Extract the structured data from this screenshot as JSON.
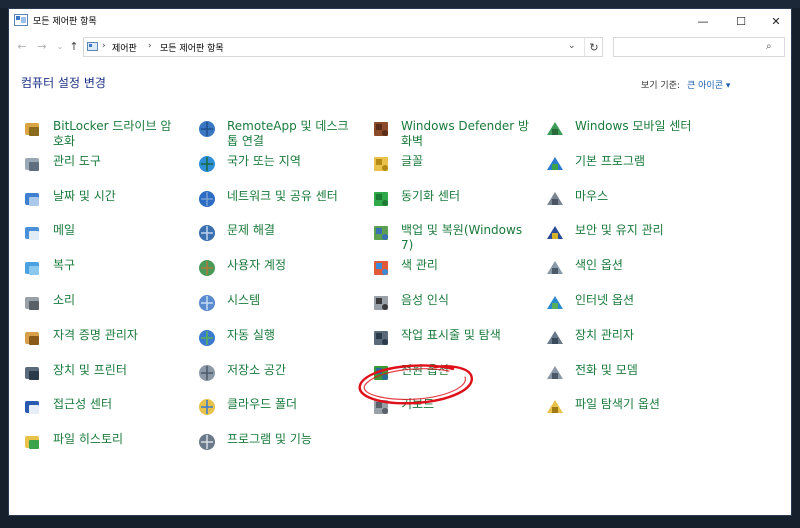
{
  "window": {
    "title": "모든 제어판 항목",
    "min_glyph": "—",
    "max_glyph": "☐",
    "close_glyph": "✕"
  },
  "nav": {
    "back": "←",
    "forward": "→",
    "recent": "⌄",
    "up": "↑"
  },
  "address": {
    "sep": "›",
    "crumbs": [
      "제어판",
      "모든 제어판 항목"
    ],
    "dropdown": "⌄",
    "refresh": "↻"
  },
  "search": {
    "placeholder": "",
    "icon": "⌕"
  },
  "heading": "컴퓨터 설정 변경",
  "view_by": {
    "label": "보기 기준:",
    "value": "큰 아이콘 ▾"
  },
  "items": [
    {
      "label": "BitLocker 드라이브 암호화",
      "icon": "bitlocker-icon"
    },
    {
      "label": "RemoteApp 및 데스크톱 연결",
      "icon": "remoteapp-icon"
    },
    {
      "label": "Windows Defender 방화벽",
      "icon": "firewall-icon"
    },
    {
      "label": "Windows 모바일 센터",
      "icon": "mobility-center-icon"
    },
    {
      "label": "관리 도구",
      "icon": "admin-tools-icon"
    },
    {
      "label": "국가 또는 지역",
      "icon": "region-icon"
    },
    {
      "label": "글꼴",
      "icon": "fonts-icon"
    },
    {
      "label": "기본 프로그램",
      "icon": "default-programs-icon"
    },
    {
      "label": "날짜 및 시간",
      "icon": "date-time-icon"
    },
    {
      "label": "네트워크 및 공유 센터",
      "icon": "network-icon"
    },
    {
      "label": "동기화 센터",
      "icon": "sync-center-icon"
    },
    {
      "label": "마우스",
      "icon": "mouse-icon"
    },
    {
      "label": "메일",
      "icon": "mail-icon"
    },
    {
      "label": "문제 해결",
      "icon": "troubleshooting-icon"
    },
    {
      "label": "백업 및 복원(Windows 7)",
      "icon": "backup-restore-icon"
    },
    {
      "label": "보안 및 유지 관리",
      "icon": "security-maintenance-icon"
    },
    {
      "label": "복구",
      "icon": "recovery-icon"
    },
    {
      "label": "사용자 계정",
      "icon": "user-accounts-icon"
    },
    {
      "label": "색 관리",
      "icon": "color-management-icon"
    },
    {
      "label": "색인 옵션",
      "icon": "indexing-options-icon"
    },
    {
      "label": "소리",
      "icon": "sound-icon"
    },
    {
      "label": "시스템",
      "icon": "system-icon"
    },
    {
      "label": "음성 인식",
      "icon": "speech-recognition-icon"
    },
    {
      "label": "인터넷 옵션",
      "icon": "internet-options-icon"
    },
    {
      "label": "자격 증명 관리자",
      "icon": "credential-manager-icon"
    },
    {
      "label": "자동 실행",
      "icon": "autoplay-icon"
    },
    {
      "label": "작업 표시줄 및 탐색",
      "icon": "taskbar-icon"
    },
    {
      "label": "장치 관리자",
      "icon": "device-manager-icon"
    },
    {
      "label": "장치 및 프린터",
      "icon": "devices-printers-icon"
    },
    {
      "label": "저장소 공간",
      "icon": "storage-spaces-icon"
    },
    {
      "label": "전원 옵션",
      "icon": "power-options-icon"
    },
    {
      "label": "전화 및 모뎀",
      "icon": "phone-modem-icon"
    },
    {
      "label": "접근성 센터",
      "icon": "ease-of-access-icon"
    },
    {
      "label": "클라우드 폴더",
      "icon": "work-folders-icon"
    },
    {
      "label": "키보드",
      "icon": "keyboard-icon"
    },
    {
      "label": "파일 탐색기 옵션",
      "icon": "file-explorer-options-icon"
    },
    {
      "label": "파일 히스토리",
      "icon": "file-history-icon"
    },
    {
      "label": "프로그램 및 기능",
      "icon": "programs-features-icon"
    }
  ],
  "colors": {
    "link_green": "#1a7a3c",
    "heading_blue": "#1e3287",
    "annotation_red": "#e0101a"
  }
}
